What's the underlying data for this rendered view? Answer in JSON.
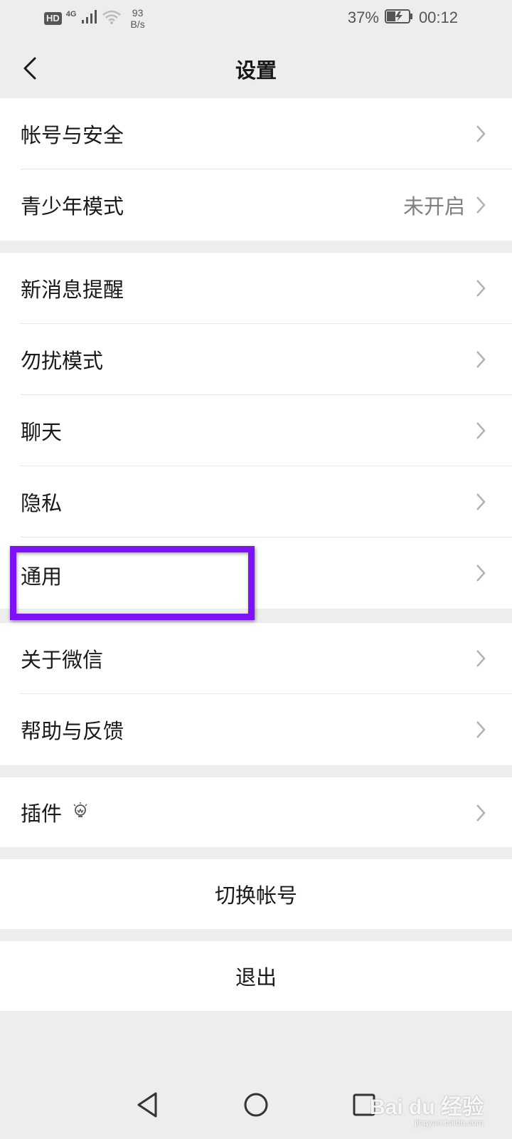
{
  "status_bar": {
    "hd": "HD",
    "network": "4G",
    "speed_value": "93",
    "speed_unit": "B/s",
    "battery": "37%",
    "time": "00:12"
  },
  "header": {
    "title": "设置"
  },
  "group1": [
    {
      "label": "帐号与安全",
      "value": ""
    },
    {
      "label": "青少年模式",
      "value": "未开启"
    }
  ],
  "group2": [
    {
      "label": "新消息提醒"
    },
    {
      "label": "勿扰模式"
    },
    {
      "label": "聊天"
    },
    {
      "label": "隐私"
    },
    {
      "label": "通用"
    }
  ],
  "group3": [
    {
      "label": "关于微信"
    },
    {
      "label": "帮助与反馈"
    }
  ],
  "group4": [
    {
      "label": "插件"
    }
  ],
  "actions": {
    "switch_account": "切换帐号",
    "logout": "退出"
  },
  "watermark": {
    "brand": "Bai du 经验",
    "url": "jingyan.baidu.com"
  },
  "colors": {
    "background": "#ededed",
    "highlight": "#7c12f5",
    "text": "#191919",
    "secondary_text": "#7f7f7f"
  }
}
